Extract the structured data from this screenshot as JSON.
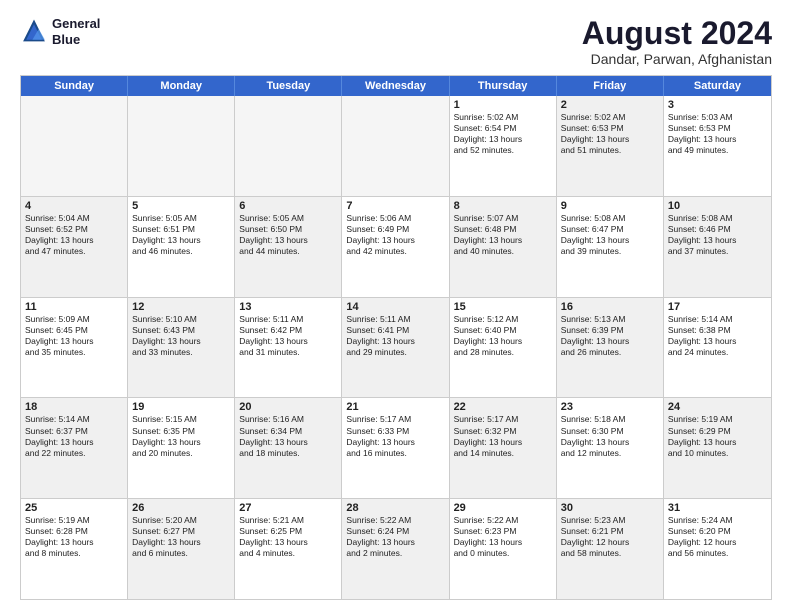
{
  "logo": {
    "line1": "General",
    "line2": "Blue"
  },
  "title": "August 2024",
  "subtitle": "Dandar, Parwan, Afghanistan",
  "days": [
    "Sunday",
    "Monday",
    "Tuesday",
    "Wednesday",
    "Thursday",
    "Friday",
    "Saturday"
  ],
  "rows": [
    [
      {
        "day": "",
        "empty": true
      },
      {
        "day": "",
        "empty": true
      },
      {
        "day": "",
        "empty": true
      },
      {
        "day": "",
        "empty": true
      },
      {
        "day": "1",
        "lines": [
          "Sunrise: 5:02 AM",
          "Sunset: 6:54 PM",
          "Daylight: 13 hours",
          "and 52 minutes."
        ]
      },
      {
        "day": "2",
        "lines": [
          "Sunrise: 5:02 AM",
          "Sunset: 6:53 PM",
          "Daylight: 13 hours",
          "and 51 minutes."
        ],
        "shaded": true
      },
      {
        "day": "3",
        "lines": [
          "Sunrise: 5:03 AM",
          "Sunset: 6:53 PM",
          "Daylight: 13 hours",
          "and 49 minutes."
        ]
      }
    ],
    [
      {
        "day": "4",
        "lines": [
          "Sunrise: 5:04 AM",
          "Sunset: 6:52 PM",
          "Daylight: 13 hours",
          "and 47 minutes."
        ],
        "shaded": true
      },
      {
        "day": "5",
        "lines": [
          "Sunrise: 5:05 AM",
          "Sunset: 6:51 PM",
          "Daylight: 13 hours",
          "and 46 minutes."
        ]
      },
      {
        "day": "6",
        "lines": [
          "Sunrise: 5:05 AM",
          "Sunset: 6:50 PM",
          "Daylight: 13 hours",
          "and 44 minutes."
        ],
        "shaded": true
      },
      {
        "day": "7",
        "lines": [
          "Sunrise: 5:06 AM",
          "Sunset: 6:49 PM",
          "Daylight: 13 hours",
          "and 42 minutes."
        ]
      },
      {
        "day": "8",
        "lines": [
          "Sunrise: 5:07 AM",
          "Sunset: 6:48 PM",
          "Daylight: 13 hours",
          "and 40 minutes."
        ],
        "shaded": true
      },
      {
        "day": "9",
        "lines": [
          "Sunrise: 5:08 AM",
          "Sunset: 6:47 PM",
          "Daylight: 13 hours",
          "and 39 minutes."
        ]
      },
      {
        "day": "10",
        "lines": [
          "Sunrise: 5:08 AM",
          "Sunset: 6:46 PM",
          "Daylight: 13 hours",
          "and 37 minutes."
        ],
        "shaded": true
      }
    ],
    [
      {
        "day": "11",
        "lines": [
          "Sunrise: 5:09 AM",
          "Sunset: 6:45 PM",
          "Daylight: 13 hours",
          "and 35 minutes."
        ]
      },
      {
        "day": "12",
        "lines": [
          "Sunrise: 5:10 AM",
          "Sunset: 6:43 PM",
          "Daylight: 13 hours",
          "and 33 minutes."
        ],
        "shaded": true
      },
      {
        "day": "13",
        "lines": [
          "Sunrise: 5:11 AM",
          "Sunset: 6:42 PM",
          "Daylight: 13 hours",
          "and 31 minutes."
        ]
      },
      {
        "day": "14",
        "lines": [
          "Sunrise: 5:11 AM",
          "Sunset: 6:41 PM",
          "Daylight: 13 hours",
          "and 29 minutes."
        ],
        "shaded": true
      },
      {
        "day": "15",
        "lines": [
          "Sunrise: 5:12 AM",
          "Sunset: 6:40 PM",
          "Daylight: 13 hours",
          "and 28 minutes."
        ]
      },
      {
        "day": "16",
        "lines": [
          "Sunrise: 5:13 AM",
          "Sunset: 6:39 PM",
          "Daylight: 13 hours",
          "and 26 minutes."
        ],
        "shaded": true
      },
      {
        "day": "17",
        "lines": [
          "Sunrise: 5:14 AM",
          "Sunset: 6:38 PM",
          "Daylight: 13 hours",
          "and 24 minutes."
        ]
      }
    ],
    [
      {
        "day": "18",
        "lines": [
          "Sunrise: 5:14 AM",
          "Sunset: 6:37 PM",
          "Daylight: 13 hours",
          "and 22 minutes."
        ],
        "shaded": true
      },
      {
        "day": "19",
        "lines": [
          "Sunrise: 5:15 AM",
          "Sunset: 6:35 PM",
          "Daylight: 13 hours",
          "and 20 minutes."
        ]
      },
      {
        "day": "20",
        "lines": [
          "Sunrise: 5:16 AM",
          "Sunset: 6:34 PM",
          "Daylight: 13 hours",
          "and 18 minutes."
        ],
        "shaded": true
      },
      {
        "day": "21",
        "lines": [
          "Sunrise: 5:17 AM",
          "Sunset: 6:33 PM",
          "Daylight: 13 hours",
          "and 16 minutes."
        ]
      },
      {
        "day": "22",
        "lines": [
          "Sunrise: 5:17 AM",
          "Sunset: 6:32 PM",
          "Daylight: 13 hours",
          "and 14 minutes."
        ],
        "shaded": true
      },
      {
        "day": "23",
        "lines": [
          "Sunrise: 5:18 AM",
          "Sunset: 6:30 PM",
          "Daylight: 13 hours",
          "and 12 minutes."
        ]
      },
      {
        "day": "24",
        "lines": [
          "Sunrise: 5:19 AM",
          "Sunset: 6:29 PM",
          "Daylight: 13 hours",
          "and 10 minutes."
        ],
        "shaded": true
      }
    ],
    [
      {
        "day": "25",
        "lines": [
          "Sunrise: 5:19 AM",
          "Sunset: 6:28 PM",
          "Daylight: 13 hours",
          "and 8 minutes."
        ]
      },
      {
        "day": "26",
        "lines": [
          "Sunrise: 5:20 AM",
          "Sunset: 6:27 PM",
          "Daylight: 13 hours",
          "and 6 minutes."
        ],
        "shaded": true
      },
      {
        "day": "27",
        "lines": [
          "Sunrise: 5:21 AM",
          "Sunset: 6:25 PM",
          "Daylight: 13 hours",
          "and 4 minutes."
        ]
      },
      {
        "day": "28",
        "lines": [
          "Sunrise: 5:22 AM",
          "Sunset: 6:24 PM",
          "Daylight: 13 hours",
          "and 2 minutes."
        ],
        "shaded": true
      },
      {
        "day": "29",
        "lines": [
          "Sunrise: 5:22 AM",
          "Sunset: 6:23 PM",
          "Daylight: 13 hours",
          "and 0 minutes."
        ]
      },
      {
        "day": "30",
        "lines": [
          "Sunrise: 5:23 AM",
          "Sunset: 6:21 PM",
          "Daylight: 12 hours",
          "and 58 minutes."
        ],
        "shaded": true
      },
      {
        "day": "31",
        "lines": [
          "Sunrise: 5:24 AM",
          "Sunset: 6:20 PM",
          "Daylight: 12 hours",
          "and 56 minutes."
        ]
      }
    ]
  ]
}
